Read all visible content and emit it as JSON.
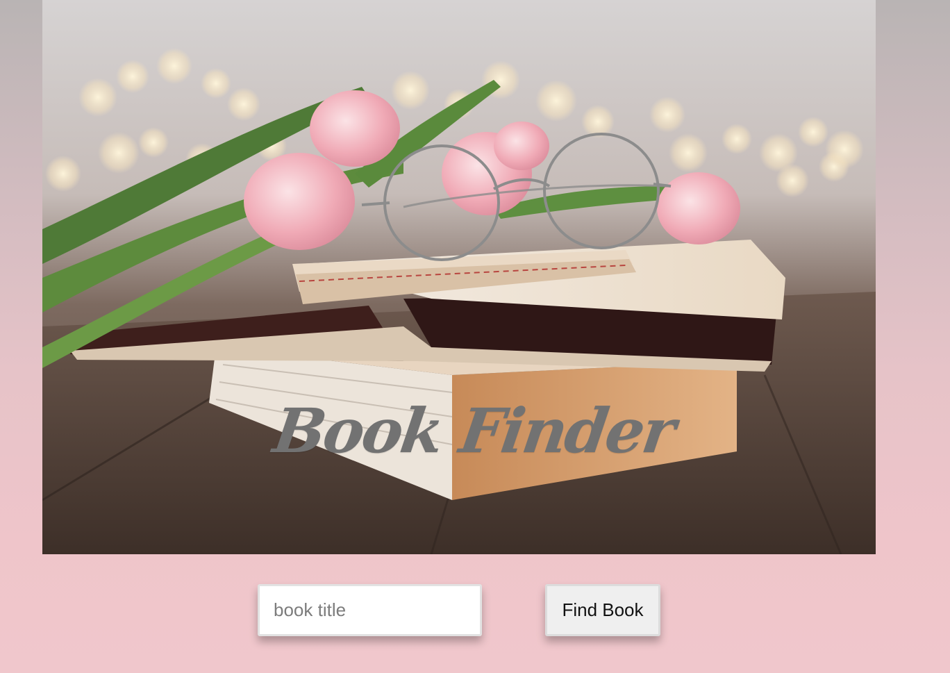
{
  "header": {
    "title": "Book Finder"
  },
  "search": {
    "value": "",
    "placeholder": "book title",
    "button_label": "Find Book"
  },
  "colors": {
    "page_background": "#efc5ca",
    "title_color": "#727272",
    "button_background": "#efefef"
  }
}
